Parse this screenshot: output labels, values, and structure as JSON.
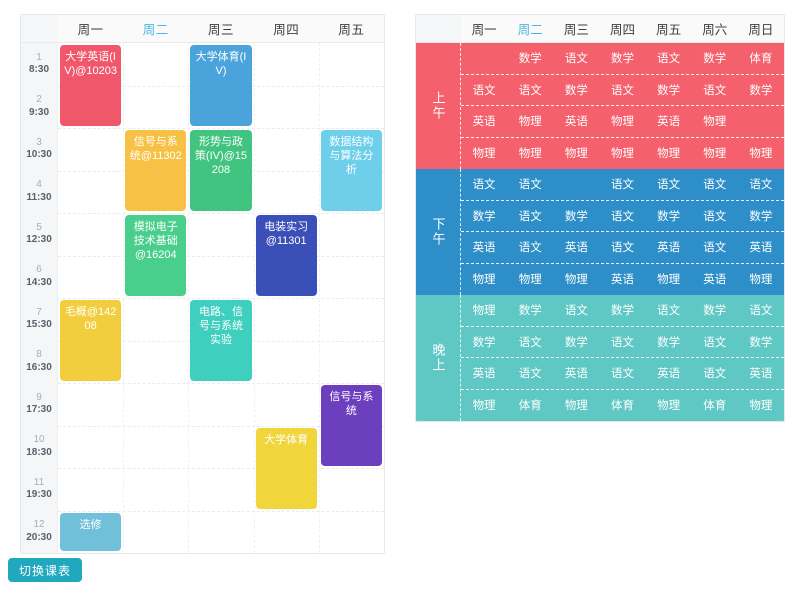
{
  "colors": {
    "morning_bg": "#F4606C",
    "afternoon_bg": "#2E8FC8",
    "evening_bg": "#5FC8C4",
    "today_highlight": "#4bb8e0",
    "toggle_button_bg": "#20a8bf"
  },
  "week_table": {
    "days": [
      {
        "label": "周一",
        "today": false
      },
      {
        "label": "周二",
        "today": true
      },
      {
        "label": "周三",
        "today": false
      },
      {
        "label": "周四",
        "today": false
      },
      {
        "label": "周五",
        "today": false
      }
    ],
    "periods": [
      {
        "num": "1",
        "time": "8:30"
      },
      {
        "num": "2",
        "time": "9:30"
      },
      {
        "num": "3",
        "time": "10:30"
      },
      {
        "num": "4",
        "time": "11:30"
      },
      {
        "num": "5",
        "time": "12:30"
      },
      {
        "num": "6",
        "time": "14:30"
      },
      {
        "num": "7",
        "time": "15:30"
      },
      {
        "num": "8",
        "time": "16:30"
      },
      {
        "num": "9",
        "time": "17:30"
      },
      {
        "num": "10",
        "time": "18:30"
      },
      {
        "num": "11",
        "time": "19:30"
      },
      {
        "num": "12",
        "time": "20:30"
      }
    ],
    "courses": [
      {
        "name": "大学英语(IV)@10203",
        "day": 0,
        "start": 1,
        "span": 2,
        "color": "#F1576A"
      },
      {
        "name": "大学体育(IV)",
        "day": 2,
        "start": 1,
        "span": 2,
        "color": "#4BA3DC"
      },
      {
        "name": "信号与系统@11302",
        "day": 1,
        "start": 3,
        "span": 2,
        "color": "#F7C146"
      },
      {
        "name": "形势与政策(IV)@15208",
        "day": 2,
        "start": 3,
        "span": 2,
        "color": "#40C47F"
      },
      {
        "name": "数据结构与算法分析",
        "day": 4,
        "start": 3,
        "span": 2,
        "color": "#6DCFEA"
      },
      {
        "name": "模拟电子技术基础@16204",
        "day": 1,
        "start": 5,
        "span": 2,
        "color": "#49CE8B"
      },
      {
        "name": "电装实习@11301",
        "day": 3,
        "start": 5,
        "span": 2,
        "color": "#3B4FB8"
      },
      {
        "name": "毛概@14208",
        "day": 0,
        "start": 7,
        "span": 2,
        "color": "#F2CE3E"
      },
      {
        "name": "电路、信号与系统实验",
        "day": 2,
        "start": 7,
        "span": 2,
        "color": "#3ECFBE"
      },
      {
        "name": "信号与系统",
        "day": 4,
        "start": 9,
        "span": 2,
        "color": "#6B3FBE"
      },
      {
        "name": "大学体育",
        "day": 3,
        "start": 10,
        "span": 2,
        "color": "#F0D53B"
      },
      {
        "name": "选修",
        "day": 0,
        "start": 12,
        "span": 1,
        "color": "#6FC0D8"
      }
    ]
  },
  "toggle": {
    "label": "切换课表"
  },
  "period_table": {
    "days": [
      {
        "label": "周一",
        "today": false
      },
      {
        "label": "周二",
        "today": true
      },
      {
        "label": "周三",
        "today": false
      },
      {
        "label": "周四",
        "today": false
      },
      {
        "label": "周五",
        "today": false
      },
      {
        "label": "周六",
        "today": false
      },
      {
        "label": "周日",
        "today": false
      }
    ],
    "sections": [
      {
        "label": "上午",
        "bg": "#F4606C",
        "rows": [
          [
            "",
            "数学",
            "语文",
            "数学",
            "语文",
            "数学",
            "体育"
          ],
          [
            "语文",
            "语文",
            "数学",
            "语文",
            "数学",
            "语文",
            "数学"
          ],
          [
            "英语",
            "物理",
            "英语",
            "物理",
            "英语",
            "物理",
            ""
          ],
          [
            "物理",
            "物理",
            "物理",
            "物理",
            "物理",
            "物理",
            "物理"
          ]
        ]
      },
      {
        "label": "下午",
        "bg": "#2E8FC8",
        "rows": [
          [
            "语文",
            "语文",
            "",
            "语文",
            "语文",
            "语文",
            "语文"
          ],
          [
            "数学",
            "语文",
            "数学",
            "语文",
            "数学",
            "语文",
            "数学"
          ],
          [
            "英语",
            "语文",
            "英语",
            "语文",
            "英语",
            "语文",
            "英语"
          ],
          [
            "物理",
            "物理",
            "物理",
            "英语",
            "物理",
            "英语",
            "物理"
          ]
        ]
      },
      {
        "label": "晚上",
        "bg": "#5FC8C4",
        "rows": [
          [
            "物理",
            "数学",
            "语文",
            "数学",
            "语文",
            "数学",
            "语文"
          ],
          [
            "数学",
            "语文",
            "数学",
            "语文",
            "数学",
            "语文",
            "数学"
          ],
          [
            "英语",
            "语文",
            "英语",
            "语文",
            "英语",
            "语文",
            "英语"
          ],
          [
            "物理",
            "体育",
            "物理",
            "体育",
            "物理",
            "体育",
            "物理"
          ]
        ]
      }
    ]
  }
}
